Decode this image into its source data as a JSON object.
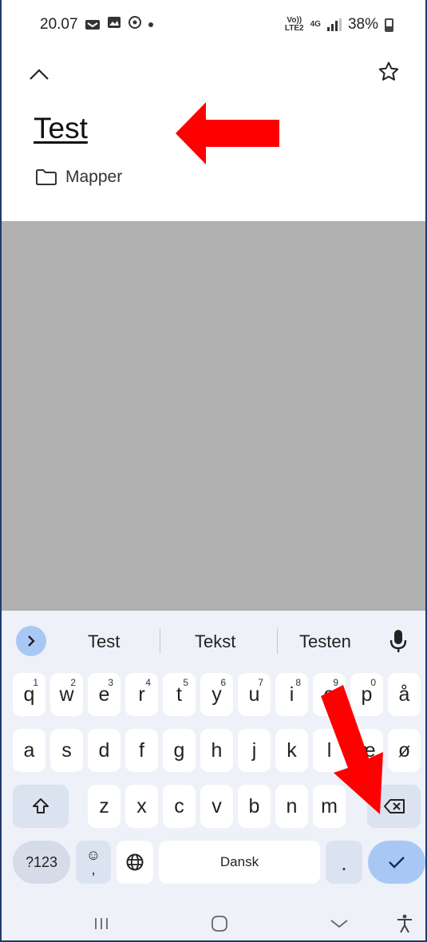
{
  "status_bar": {
    "time": "20.07",
    "network_top": "Vo))",
    "network_bottom": "LTE2",
    "data_type": "4G",
    "battery": "38%"
  },
  "note": {
    "title": "Test",
    "folder_label": "Mapper"
  },
  "keyboard": {
    "suggestions": [
      "Test",
      "Tekst",
      "Testen"
    ],
    "row1": [
      {
        "key": "q",
        "hint": "1"
      },
      {
        "key": "w",
        "hint": "2"
      },
      {
        "key": "e",
        "hint": "3"
      },
      {
        "key": "r",
        "hint": "4"
      },
      {
        "key": "t",
        "hint": "5"
      },
      {
        "key": "y",
        "hint": "6"
      },
      {
        "key": "u",
        "hint": "7"
      },
      {
        "key": "i",
        "hint": "8"
      },
      {
        "key": "o",
        "hint": "9"
      },
      {
        "key": "p",
        "hint": "0"
      },
      {
        "key": "å",
        "hint": ""
      }
    ],
    "row2": [
      "a",
      "s",
      "d",
      "f",
      "g",
      "h",
      "j",
      "k",
      "l",
      "æ",
      "ø"
    ],
    "row3": [
      "z",
      "x",
      "c",
      "v",
      "b",
      "n",
      "m"
    ],
    "num_label": "?123",
    "emoji_symbol": "☺",
    "comma": ",",
    "space_label": "Dansk",
    "period": "."
  },
  "icons": {
    "collapse": "chevron-up-icon",
    "favorite": "star-outline-icon",
    "folder": "folder-icon",
    "expand": "chevron-right-icon",
    "mic": "microphone-icon",
    "shift": "shift-icon",
    "backspace": "backspace-icon",
    "language": "globe-icon",
    "enter": "checkmark-icon",
    "nav_recents": "recents-icon",
    "nav_home": "home-icon",
    "nav_back": "back-icon",
    "nav_accessibility": "accessibility-icon"
  },
  "colors": {
    "annotation_arrow": "#ff0000",
    "gray_area": "#b0b0b0",
    "keyboard_bg": "#eef1f8",
    "accent_blue": "#a9c7f5"
  }
}
